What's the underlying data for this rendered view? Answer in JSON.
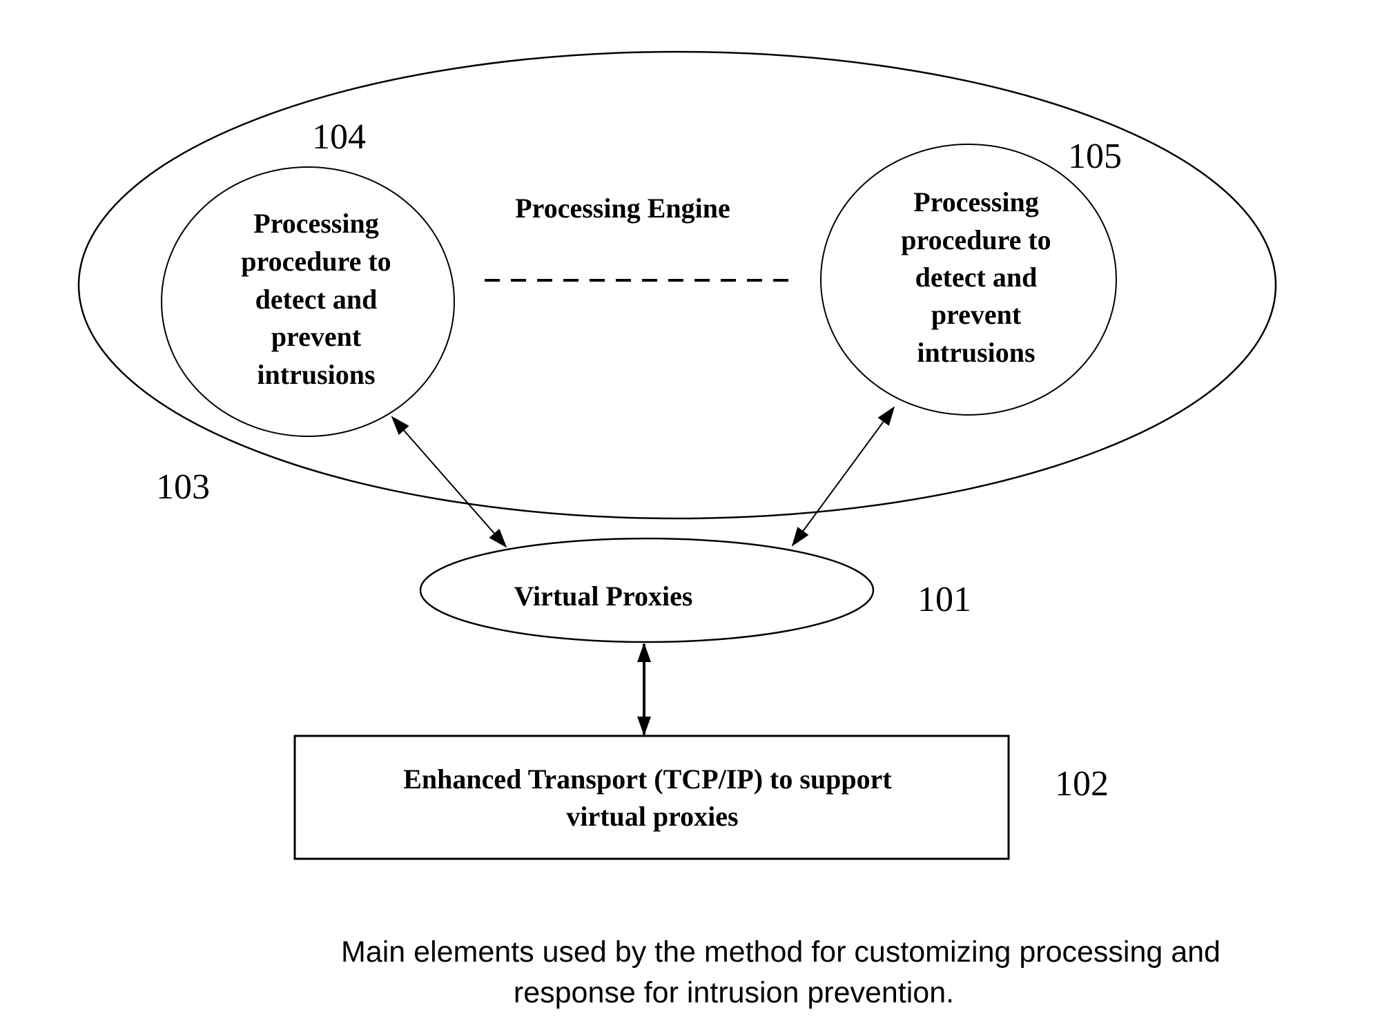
{
  "diagram": {
    "engine": {
      "label": "Processing Engine",
      "ref": "103"
    },
    "procedures": [
      {
        "ref": "104",
        "lines": [
          "Processing",
          "procedure to",
          "detect and",
          "prevent",
          "intrusions"
        ]
      },
      {
        "ref": "105",
        "lines": [
          "Processing",
          "procedure to",
          "detect and",
          "prevent",
          "intrusions"
        ]
      }
    ],
    "proxies": {
      "label": "Virtual Proxies",
      "ref": "101"
    },
    "transport": {
      "lines": [
        "Enhanced Transport (TCP/IP) to support",
        "virtual proxies"
      ],
      "ref": "102"
    },
    "connections": [
      {
        "from": "104",
        "to": "101",
        "type": "bidirectional"
      },
      {
        "from": "105",
        "to": "101",
        "type": "bidirectional"
      },
      {
        "from": "101",
        "to": "102",
        "type": "bidirectional"
      },
      {
        "from": "104",
        "to": "105",
        "type": "dashed-continuation"
      }
    ]
  },
  "caption": {
    "lines": [
      "Main elements used by the method for customizing processing and",
      "response for intrusion prevention."
    ]
  }
}
